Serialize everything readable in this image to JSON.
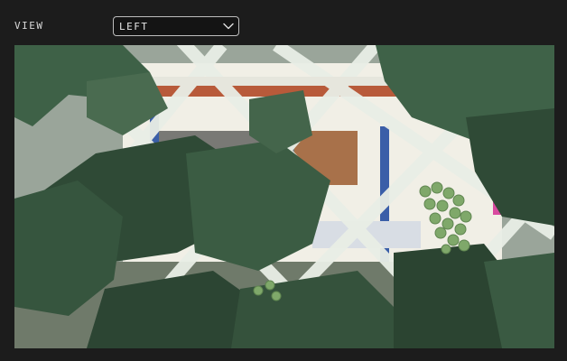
{
  "view": {
    "label": "VIEW",
    "selected": "LEFT",
    "icon": "chevron-down-icon"
  },
  "camera_feed": {
    "icon": "camera-image",
    "colors": {
      "leaf_dark": "#2f4a36",
      "leaf_mid": "#3d5b44",
      "lattice": "#e9eee6",
      "grape": "#7fa86a",
      "wall": "#f1efe6",
      "roof": "#b85a3a"
    }
  }
}
